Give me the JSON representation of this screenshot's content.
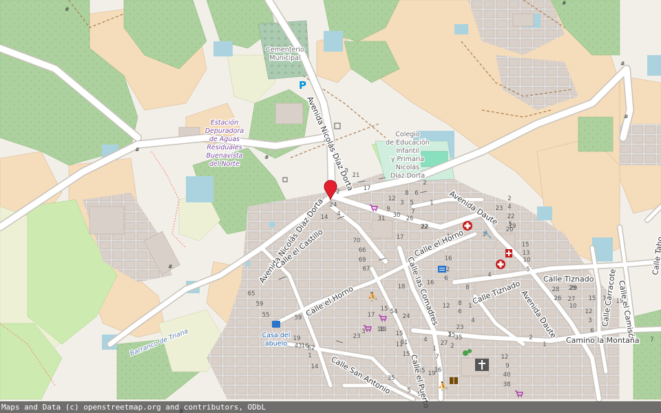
{
  "map": {
    "attribution": "Maps and Data (c) openstreetmap.org and contributors, ODbL",
    "marker": {
      "label": "Map marker"
    },
    "streets": [
      {
        "id": "avenida-nicolas-diaz-dorta-1",
        "name": "Avenida Nicolás Díaz Dorta"
      },
      {
        "id": "avenida-nicolas-diaz-dorta-2",
        "name": "Avenida Nicolás Díaz Dorta"
      },
      {
        "id": "calle-el-castillo",
        "name": "Calle el Castillo"
      },
      {
        "id": "calle-el-horno-1",
        "name": "Calle el Horno"
      },
      {
        "id": "calle-el-horno-2",
        "name": "Calle el Horno"
      },
      {
        "id": "calle-las-cornadres",
        "name": "Calle las Comadres"
      },
      {
        "id": "calle-el-puerto",
        "name": "Calle el Puerto"
      },
      {
        "id": "calle-san-antonio",
        "name": "Calle San Antonio"
      },
      {
        "id": "avenida-daute-1",
        "name": "Avenida Daute"
      },
      {
        "id": "avenida-daute-2",
        "name": "Avenida Daute"
      },
      {
        "id": "calle-tiznado-1",
        "name": "Calle Tiznado"
      },
      {
        "id": "calle-tiznado-2",
        "name": "Calle Tiznado"
      },
      {
        "id": "calle-carracote",
        "name": "Calle Carracote"
      },
      {
        "id": "calle-el-camison",
        "name": "Calle el Camisón"
      },
      {
        "id": "calle-tahona",
        "name": "Calle Taho"
      },
      {
        "id": "camino-la-montana",
        "name": "Camino la Montaña"
      }
    ],
    "pois": {
      "cementerio": [
        "Cementerio",
        "Municipal"
      ],
      "estacion": [
        "Estación",
        "Depuradora",
        "de Aguas",
        "Residuales",
        "Buenavista",
        "del Norte"
      ],
      "colegio": [
        "Colegio",
        "de Educación",
        "Infantil",
        "y Primaria",
        "Nicolás",
        "Díaz Dorta"
      ],
      "casa_abuelo": [
        "Casa del",
        "abuelo"
      ],
      "barranco": "Barranco de Triana",
      "parking": "P"
    },
    "house_numbers": [
      "2",
      "21",
      "17",
      "24",
      "2",
      "4",
      "2",
      "8",
      "5",
      "6",
      "12",
      "9",
      "3",
      "7",
      "1",
      "14",
      "31",
      "30",
      "26",
      "22",
      "12",
      "16",
      "17",
      "70",
      "66",
      "69",
      "67",
      "2",
      "4",
      "3",
      "5",
      "23",
      "22",
      "20",
      "19",
      "15",
      "13",
      "10",
      "5",
      "4",
      "18",
      "16",
      "12",
      "8",
      "28",
      "26",
      "29",
      "6",
      "22",
      "65",
      "59",
      "55",
      "59",
      "54",
      "24",
      "12",
      "8",
      "6",
      "1",
      "4",
      "19",
      "16",
      "1",
      "14",
      "3",
      "13",
      "15",
      "11",
      "15",
      "18",
      "15",
      "17",
      "43",
      "62",
      "23",
      "35",
      "51",
      "55",
      "19",
      "35",
      "15",
      "23",
      "27",
      "1",
      "7",
      "16",
      "9",
      "5",
      "3",
      "2",
      "4",
      "2",
      "1",
      "12",
      "9",
      "40",
      "38",
      "29",
      "27",
      "10",
      "15",
      "11",
      "19",
      "7",
      "12",
      "3",
      "6",
      "8"
    ],
    "colors": {
      "forest": "#add19e",
      "farmland": "#eef0d5",
      "residential": "#e0dfdf",
      "farmyard": "#f5dcba",
      "grass": "#cdebb0",
      "building": "#d9d0c9",
      "water": "#aad3df",
      "road": "#ffffff",
      "marker": "#e4202e"
    }
  }
}
